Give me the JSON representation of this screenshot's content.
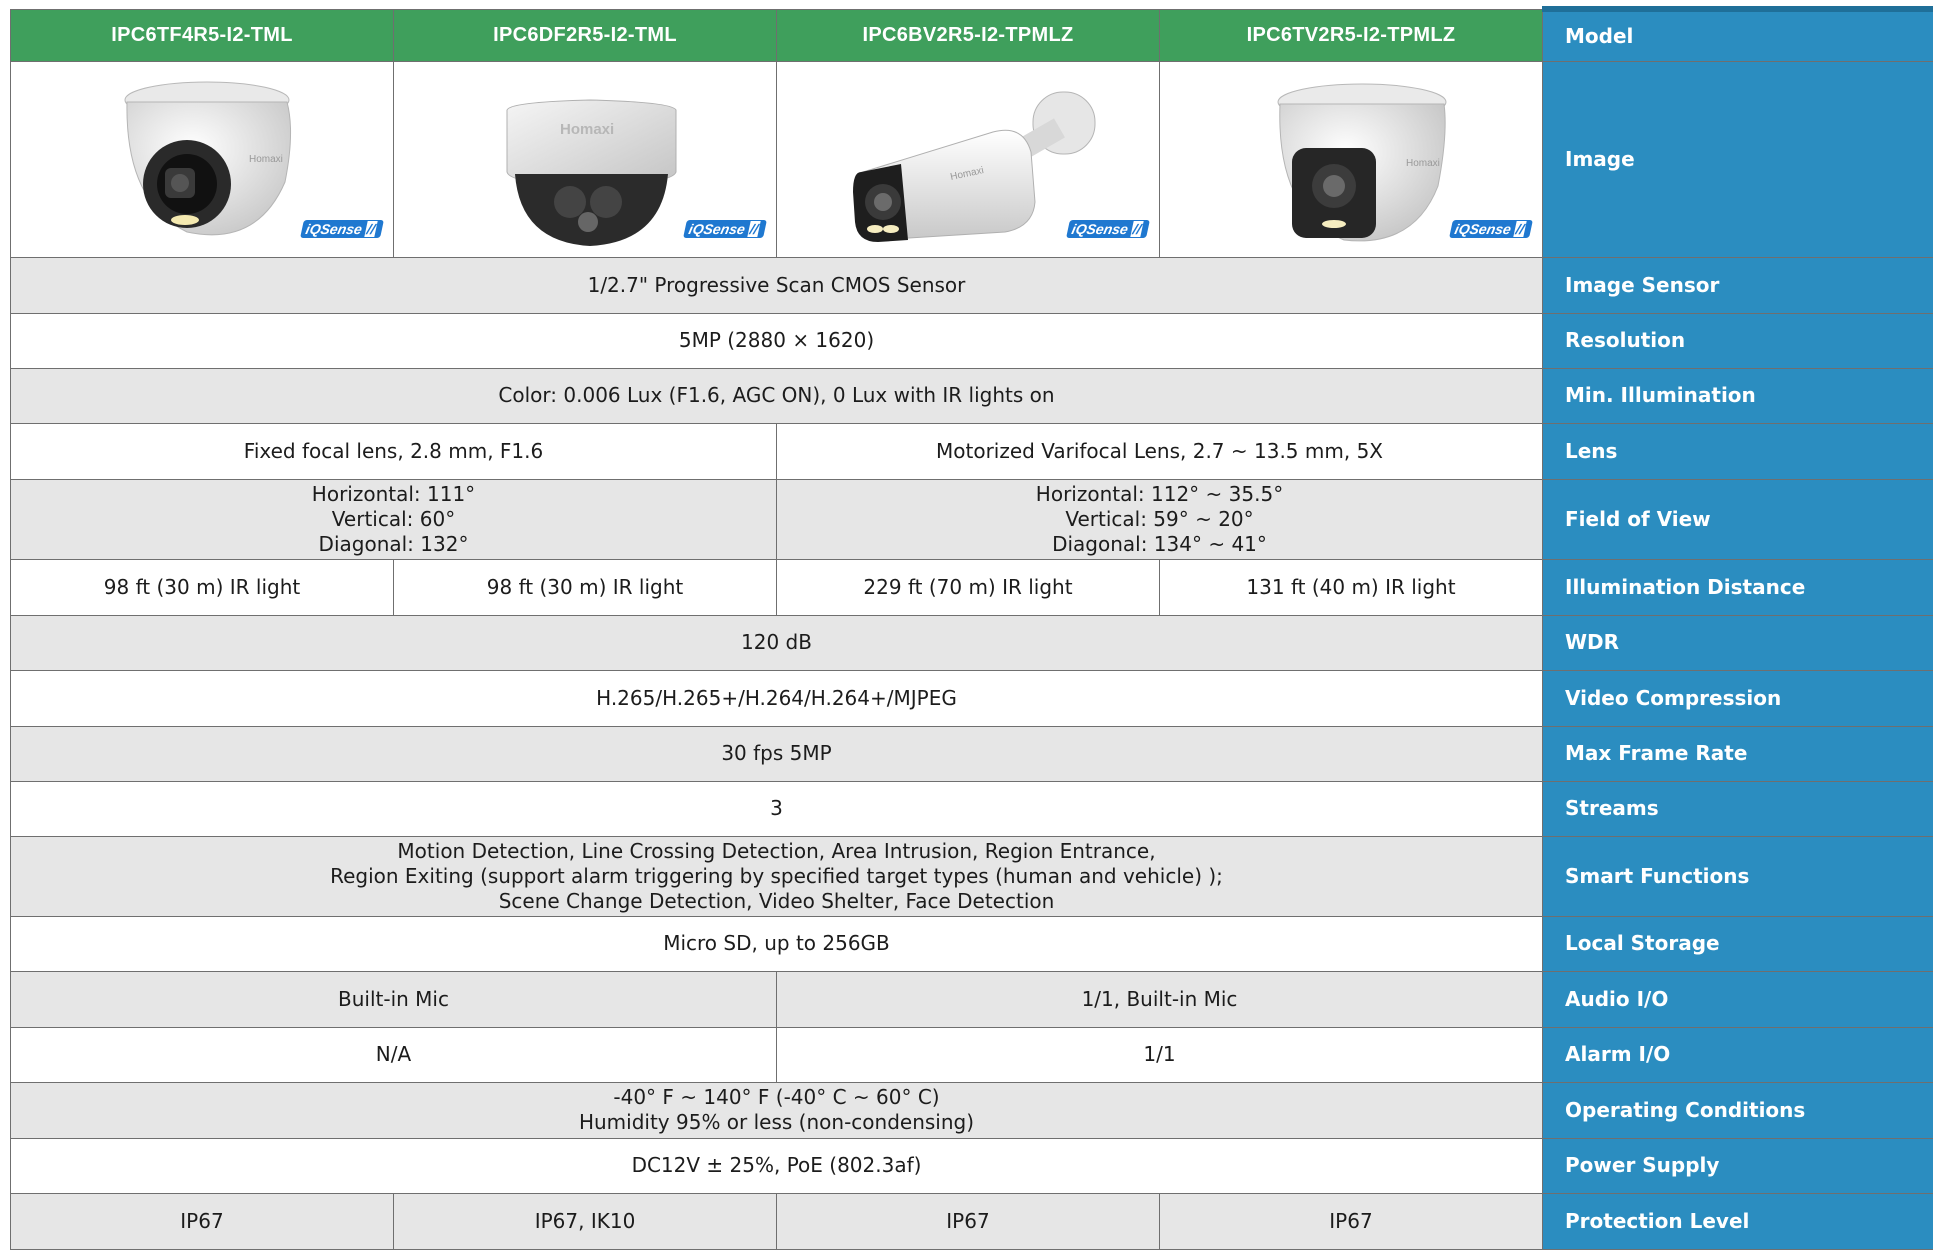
{
  "models": [
    "IPC6TF4R5-I2-TML",
    "IPC6DF2R5-I2-TML",
    "IPC6BV2R5-I2-TPMLZ",
    "IPC6TV2R5-I2-TPMLZ"
  ],
  "labels": {
    "model": "Model",
    "image": "Image",
    "image_sensor": "Image Sensor",
    "resolution": "Resolution",
    "min_illumination": "Min. Illumination",
    "lens": "Lens",
    "field_of_view": "Field of View",
    "illumination_distance": "Illumination Distance",
    "wdr": "WDR",
    "video_compression": "Video Compression",
    "max_frame_rate": "Max Frame Rate",
    "streams": "Streams",
    "smart_functions": "Smart Functions",
    "local_storage": "Local Storage",
    "audio_io": "Audio I/O",
    "alarm_io": "Alarm I/O",
    "operating_conditions": "Operating Conditions",
    "power_supply": "Power Supply",
    "protection_level": "Protection Level"
  },
  "images": [
    {
      "icon": "turret-camera-image",
      "brand": "Homaxi",
      "badge": "iQSense"
    },
    {
      "icon": "dome-camera-image",
      "brand": "Homaxi",
      "badge": "iQSense"
    },
    {
      "icon": "bullet-camera-image",
      "brand": "Homaxi",
      "badge": "iQSense"
    },
    {
      "icon": "turret-varifocal-camera-image",
      "brand": "Homaxi",
      "badge": "iQSense"
    }
  ],
  "specs": {
    "image_sensor": "1/2.7\" Progressive Scan CMOS Sensor",
    "resolution": "5MP (2880 × 1620)",
    "min_illumination": "Color: 0.006 Lux (F1.6, AGC ON), 0 Lux with IR lights on",
    "lens": [
      "Fixed focal lens, 2.8 mm, F1.6",
      "Motorized Varifocal Lens, 2.7 ~ 13.5 mm, 5X"
    ],
    "field_of_view": [
      {
        "h": "Horizontal: 111°",
        "v": "Vertical: 60°",
        "d": "Diagonal: 132°"
      },
      {
        "h": "Horizontal: 112° ~ 35.5°",
        "v": "Vertical: 59° ~ 20°",
        "d": "Diagonal: 134° ~ 41°"
      }
    ],
    "illumination_distance": [
      "98 ft (30 m) IR light",
      "98 ft (30 m) IR light",
      "229 ft (70 m) IR light",
      "131 ft (40 m) IR light"
    ],
    "wdr": "120 dB",
    "video_compression": "H.265/H.265+/H.264/H.264+/MJPEG",
    "max_frame_rate": "30 fps 5MP",
    "streams": "3",
    "smart_functions": [
      "Motion Detection, Line Crossing Detection, Area Intrusion, Region Entrance,",
      "Region Exiting (support alarm triggering by specified target types (human and vehicle) );",
      "Scene Change Detection, Video Shelter, Face Detection"
    ],
    "local_storage": "Micro SD, up to 256GB",
    "audio_io": [
      "Built-in Mic",
      "1/1, Built-in Mic"
    ],
    "alarm_io": [
      "N/A",
      "1/1"
    ],
    "operating_conditions": [
      "-40° F ~ 140° F (-40° C ~ 60° C)",
      "Humidity 95% or less (non-condensing)"
    ],
    "power_supply": "DC12V ± 25%, PoE (802.3af)",
    "protection_level": [
      "IP67",
      "IP67, IK10",
      "IP67",
      "IP67"
    ]
  },
  "colors": {
    "model_header": "#3f9f5c",
    "label_column": "#2b8dc0",
    "gray_row": "#e6e6e6"
  }
}
